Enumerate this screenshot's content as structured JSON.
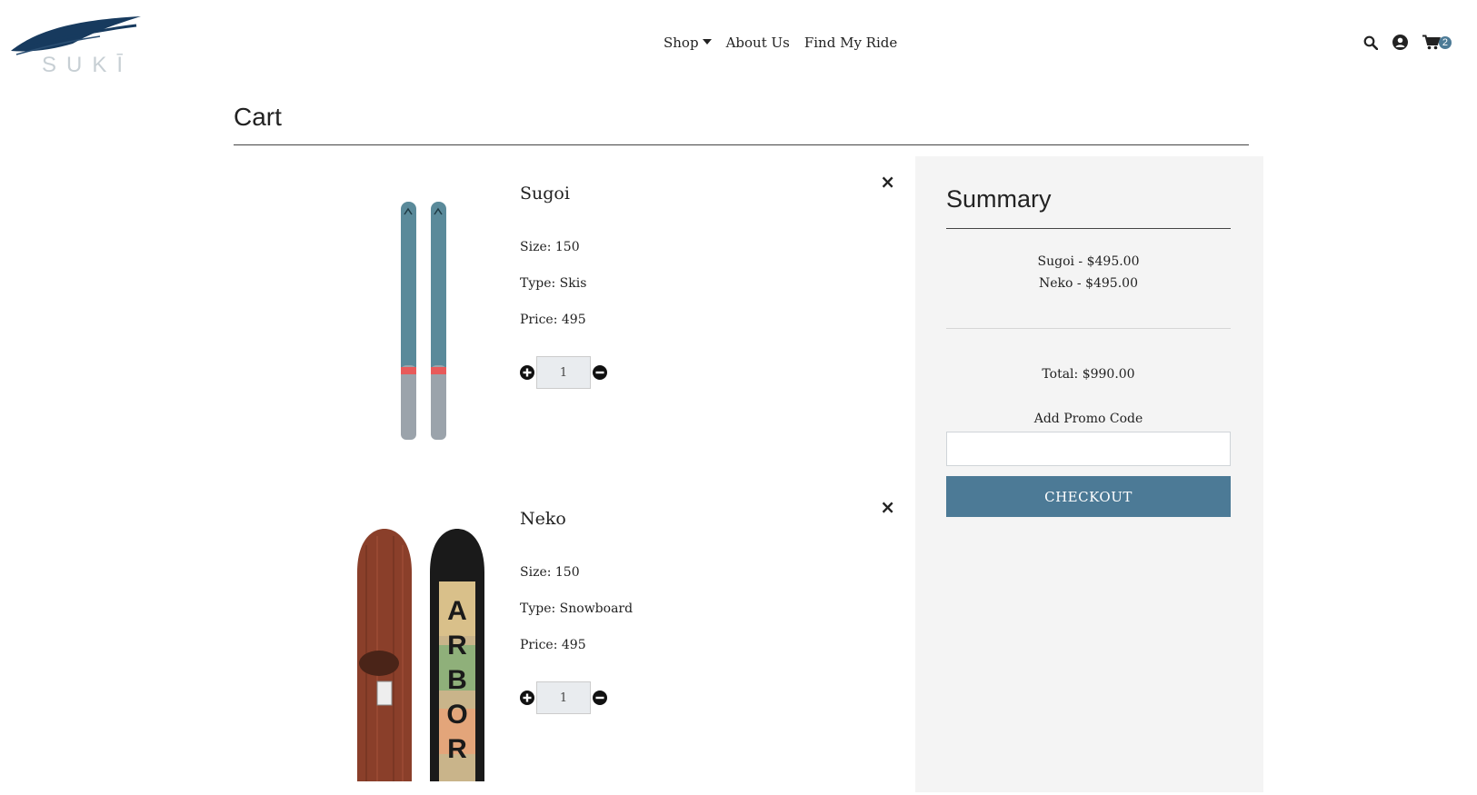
{
  "brand": {
    "logo_text": "SUKĪ",
    "accent": "#4c7a96"
  },
  "nav": {
    "shop": "Shop",
    "about": "About Us",
    "find": "Find My Ride"
  },
  "header": {
    "cart_count": "2"
  },
  "page": {
    "title": "Cart"
  },
  "items": [
    {
      "name": "Sugoi",
      "size": "Size: 150",
      "type": "Type: Skis",
      "price": "Price: 495",
      "quantity": "1",
      "remove": "×"
    },
    {
      "name": "Neko",
      "size": "Size: 150",
      "type": "Type: Snowboard",
      "price": "Price: 495",
      "quantity": "1",
      "remove": "×",
      "board_text": "ARBOR"
    }
  ],
  "summary": {
    "title": "Summary",
    "lines": [
      "Sugoi - $495.00",
      "Neko - $495.00"
    ],
    "total": "Total: $990.00",
    "promo_label": "Add Promo Code",
    "promo_value": "",
    "checkout": "CHECKOUT"
  }
}
